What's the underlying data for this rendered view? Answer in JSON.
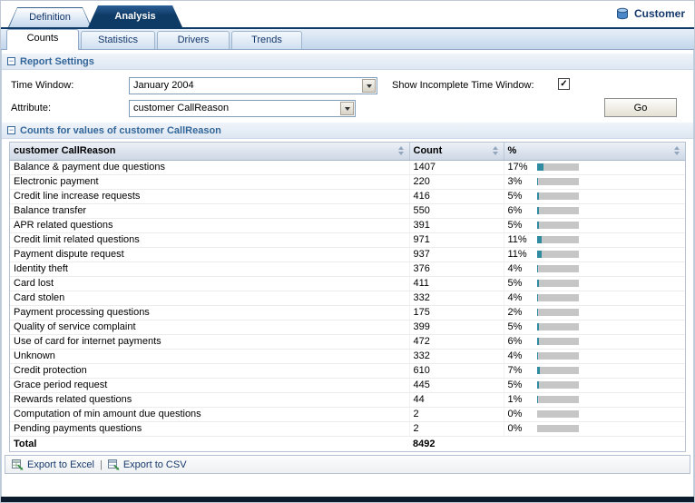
{
  "brand": {
    "label": "Customer"
  },
  "main_tabs": [
    {
      "label": "Definition",
      "selected": false
    },
    {
      "label": "Analysis",
      "selected": true
    }
  ],
  "sub_tabs": [
    {
      "label": "Counts",
      "selected": true
    },
    {
      "label": "Statistics",
      "selected": false
    },
    {
      "label": "Drivers",
      "selected": false
    },
    {
      "label": "Trends",
      "selected": false
    }
  ],
  "report_settings": {
    "title": "Report Settings",
    "time_window": {
      "label": "Time Window:",
      "value": "January 2004"
    },
    "attribute": {
      "label": "Attribute:",
      "value": "customer CallReason"
    },
    "show_incomplete": {
      "label": "Show Incomplete Time Window:",
      "checked": true
    },
    "go_button": "Go"
  },
  "counts": {
    "title": "Counts for values of customer CallReason",
    "columns": [
      "customer CallReason",
      "Count",
      "%"
    ],
    "rows": [
      {
        "reason": "Balance & payment due questions",
        "count": "1407",
        "pct_label": "17%",
        "pct": 17
      },
      {
        "reason": "Electronic payment",
        "count": "220",
        "pct_label": "3%",
        "pct": 3
      },
      {
        "reason": "Credit line increase requests",
        "count": "416",
        "pct_label": "5%",
        "pct": 5
      },
      {
        "reason": "Balance transfer",
        "count": "550",
        "pct_label": "6%",
        "pct": 6
      },
      {
        "reason": "APR related questions",
        "count": "391",
        "pct_label": "5%",
        "pct": 5
      },
      {
        "reason": "Credit limit related questions",
        "count": "971",
        "pct_label": "11%",
        "pct": 11
      },
      {
        "reason": "Payment dispute request",
        "count": "937",
        "pct_label": "11%",
        "pct": 11
      },
      {
        "reason": "Identity theft",
        "count": "376",
        "pct_label": "4%",
        "pct": 4
      },
      {
        "reason": "Card lost",
        "count": "411",
        "pct_label": "5%",
        "pct": 5
      },
      {
        "reason": "Card stolen",
        "count": "332",
        "pct_label": "4%",
        "pct": 4
      },
      {
        "reason": "Payment processing questions",
        "count": "175",
        "pct_label": "2%",
        "pct": 2
      },
      {
        "reason": "Quality of service complaint",
        "count": "399",
        "pct_label": "5%",
        "pct": 5
      },
      {
        "reason": "Use of card for internet payments",
        "count": "472",
        "pct_label": "6%",
        "pct": 6
      },
      {
        "reason": "Unknown",
        "count": "332",
        "pct_label": "4%",
        "pct": 4
      },
      {
        "reason": "Credit protection",
        "count": "610",
        "pct_label": "7%",
        "pct": 7
      },
      {
        "reason": "Grace period request",
        "count": "445",
        "pct_label": "5%",
        "pct": 5
      },
      {
        "reason": "Rewards related questions",
        "count": "44",
        "pct_label": "1%",
        "pct": 1
      },
      {
        "reason": "Computation of min amount due questions",
        "count": "2",
        "pct_label": "0%",
        "pct": 0
      },
      {
        "reason": "Pending payments questions",
        "count": "2",
        "pct_label": "0%",
        "pct": 0
      }
    ],
    "total": {
      "label": "Total",
      "count": "8492"
    }
  },
  "footer": {
    "export_excel": "Export to Excel",
    "separator": "|",
    "export_csv": "Export to CSV"
  },
  "icons": {
    "collapse_glyph": "−",
    "check_glyph": "✓"
  },
  "colors": {
    "accent_blue": "#336699",
    "tab_dark": "#0E3A66",
    "bar_fill": "#2F8BA0",
    "bar_track": "#C6C6C6"
  }
}
